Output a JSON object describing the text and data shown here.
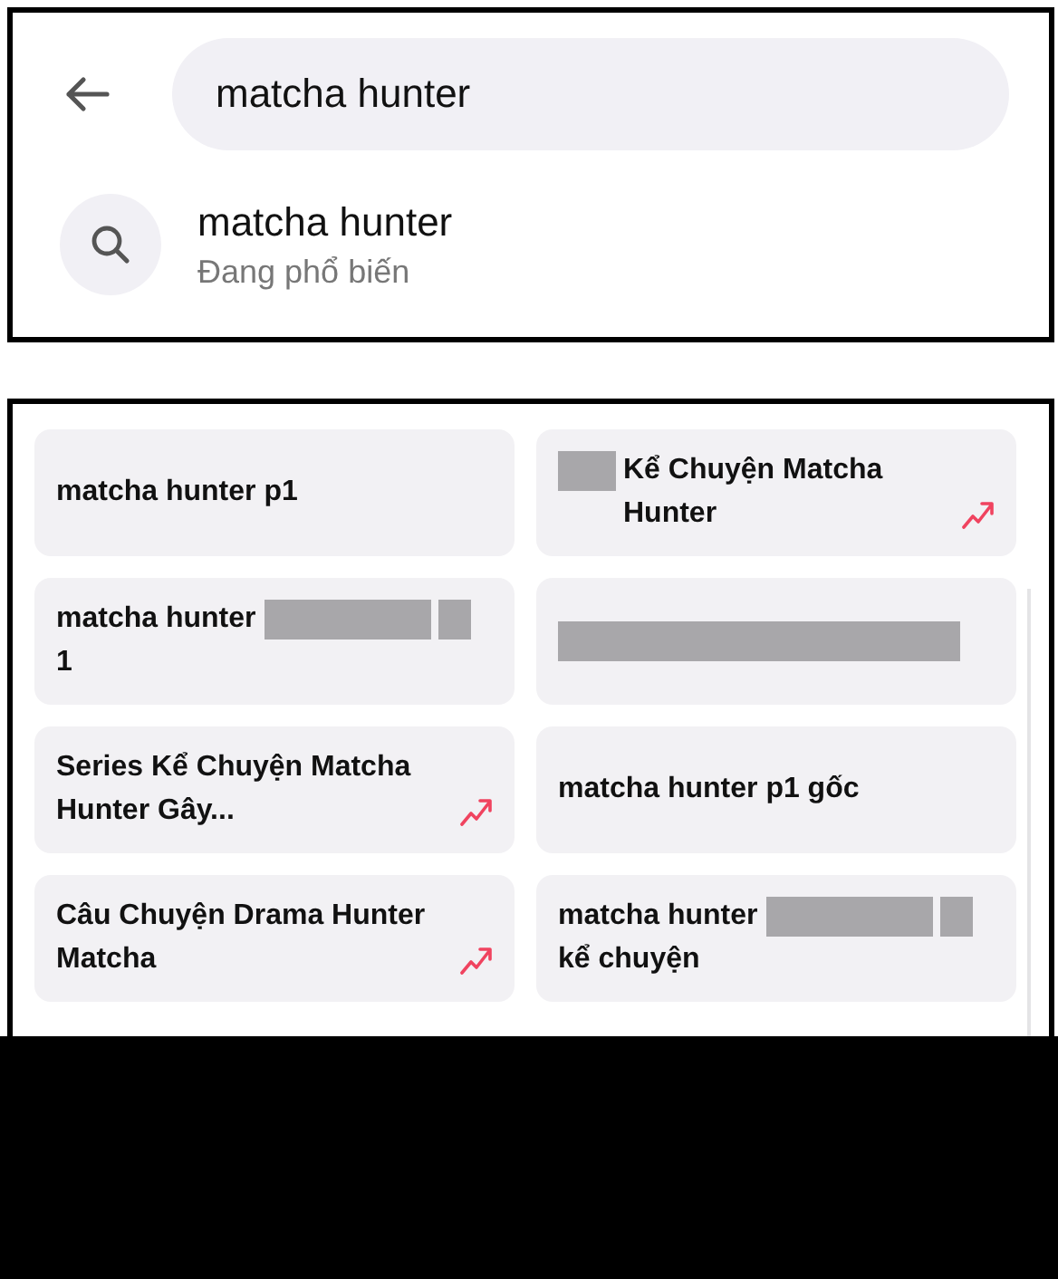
{
  "search": {
    "value": "matcha hunter"
  },
  "suggestion": {
    "title": "matcha hunter",
    "subtitle": "Đang phổ biến"
  },
  "tiles": [
    {
      "trending": false,
      "parts": [
        {
          "kind": "text",
          "text": "matcha hunter p1"
        }
      ]
    },
    {
      "trending": true,
      "parts": [
        {
          "kind": "redaction"
        },
        {
          "kind": "text",
          "text": "Kể Chuyện Matcha Hunter"
        }
      ]
    },
    {
      "trending": false,
      "parts": [
        {
          "kind": "text",
          "text": "matcha hunter"
        },
        {
          "kind": "redaction"
        },
        {
          "kind": "redaction"
        },
        {
          "kind": "text",
          "text": "1"
        }
      ]
    },
    {
      "trending": false,
      "parts": [
        {
          "kind": "redaction"
        }
      ]
    },
    {
      "trending": true,
      "parts": [
        {
          "kind": "text",
          "text": "Series Kể Chuyện Matcha Hunter Gây..."
        }
      ]
    },
    {
      "trending": false,
      "parts": [
        {
          "kind": "text",
          "text": "matcha hunter p1 gốc"
        }
      ]
    },
    {
      "trending": true,
      "parts": [
        {
          "kind": "text",
          "text": "Câu Chuyện Drama Hunter Matcha"
        }
      ]
    },
    {
      "trending": false,
      "parts": [
        {
          "kind": "text",
          "text": "matcha hunter"
        },
        {
          "kind": "redaction"
        },
        {
          "kind": "redaction"
        },
        {
          "kind": "text",
          "text": "kể chuyện"
        }
      ]
    }
  ]
}
